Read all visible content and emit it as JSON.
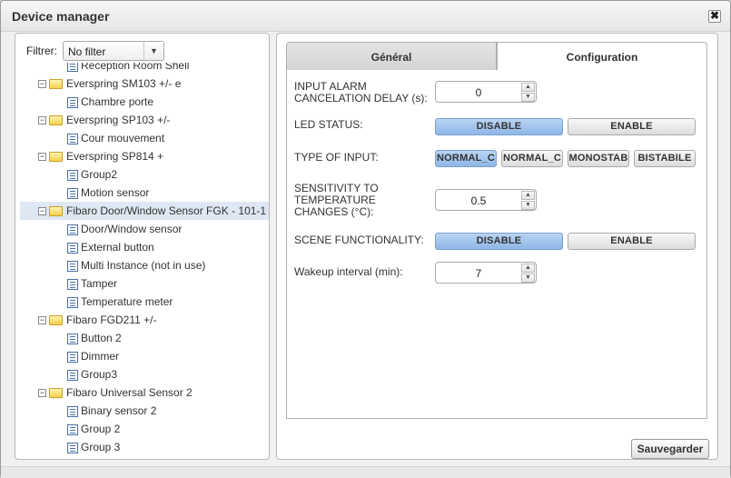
{
  "dialog": {
    "title": "Device manager",
    "close_glyph": "✖"
  },
  "filter": {
    "label": "Filtrer:",
    "value": "No filter",
    "arrow": "▼"
  },
  "tree": [
    {
      "type": "child",
      "label": "Reception Room Shell"
    },
    {
      "type": "group",
      "label": "Everspring SM103 +/- e"
    },
    {
      "type": "child",
      "label": "Chambre porte"
    },
    {
      "type": "group",
      "label": "Everspring SP103 +/-"
    },
    {
      "type": "child",
      "label": "Cour mouvement"
    },
    {
      "type": "group",
      "label": "Everspring SP814 +"
    },
    {
      "type": "child",
      "label": "Group2"
    },
    {
      "type": "child",
      "label": "Motion sensor"
    },
    {
      "type": "group",
      "label": "Fibaro Door/Window Sensor FGK - 101-1",
      "selected": true
    },
    {
      "type": "child",
      "label": "Door/Window sensor"
    },
    {
      "type": "child",
      "label": "External button"
    },
    {
      "type": "child",
      "label": "Multi Instance (not in use)"
    },
    {
      "type": "child",
      "label": "Tamper"
    },
    {
      "type": "child",
      "label": "Temperature meter"
    },
    {
      "type": "group",
      "label": "Fibaro FGD211 +/-"
    },
    {
      "type": "child",
      "label": "Button 2"
    },
    {
      "type": "child",
      "label": "Dimmer"
    },
    {
      "type": "child",
      "label": "Group3"
    },
    {
      "type": "group",
      "label": "Fibaro Universal Sensor 2"
    },
    {
      "type": "child",
      "label": "Binary sensor 2"
    },
    {
      "type": "child",
      "label": "Group 2"
    },
    {
      "type": "child",
      "label": "Group 3"
    }
  ],
  "tabs": {
    "general": "Général",
    "configuration": "Configuration",
    "active": "configuration"
  },
  "config": {
    "alarm_delay": {
      "label_line1": "INPUT ALARM",
      "label_line2": "CANCELATION DELAY (s):",
      "value": "0"
    },
    "led_status": {
      "label": "LED STATUS:",
      "options": [
        "DISABLE",
        "ENABLE"
      ],
      "selected": "DISABLE"
    },
    "type_of_input": {
      "label": "TYPE OF INPUT:",
      "options": [
        "NORMAL_C",
        "NORMAL_C",
        "MONOSTAB",
        "BISTABILE"
      ],
      "selected_index": 0
    },
    "sensitivity": {
      "label_line1": "SENSITIVITY TO",
      "label_line2": "TEMPERATURE",
      "label_line3": "CHANGES (°C):",
      "value": "0.5"
    },
    "scene_functionality": {
      "label": "SCENE FUNCTIONALITY:",
      "options": [
        "DISABLE",
        "ENABLE"
      ],
      "selected": "DISABLE"
    },
    "wakeup": {
      "label": "Wakeup interval (min):",
      "value": "7"
    },
    "spinner_up": "▲",
    "spinner_down": "▼"
  },
  "save_button": "Sauvegarder"
}
